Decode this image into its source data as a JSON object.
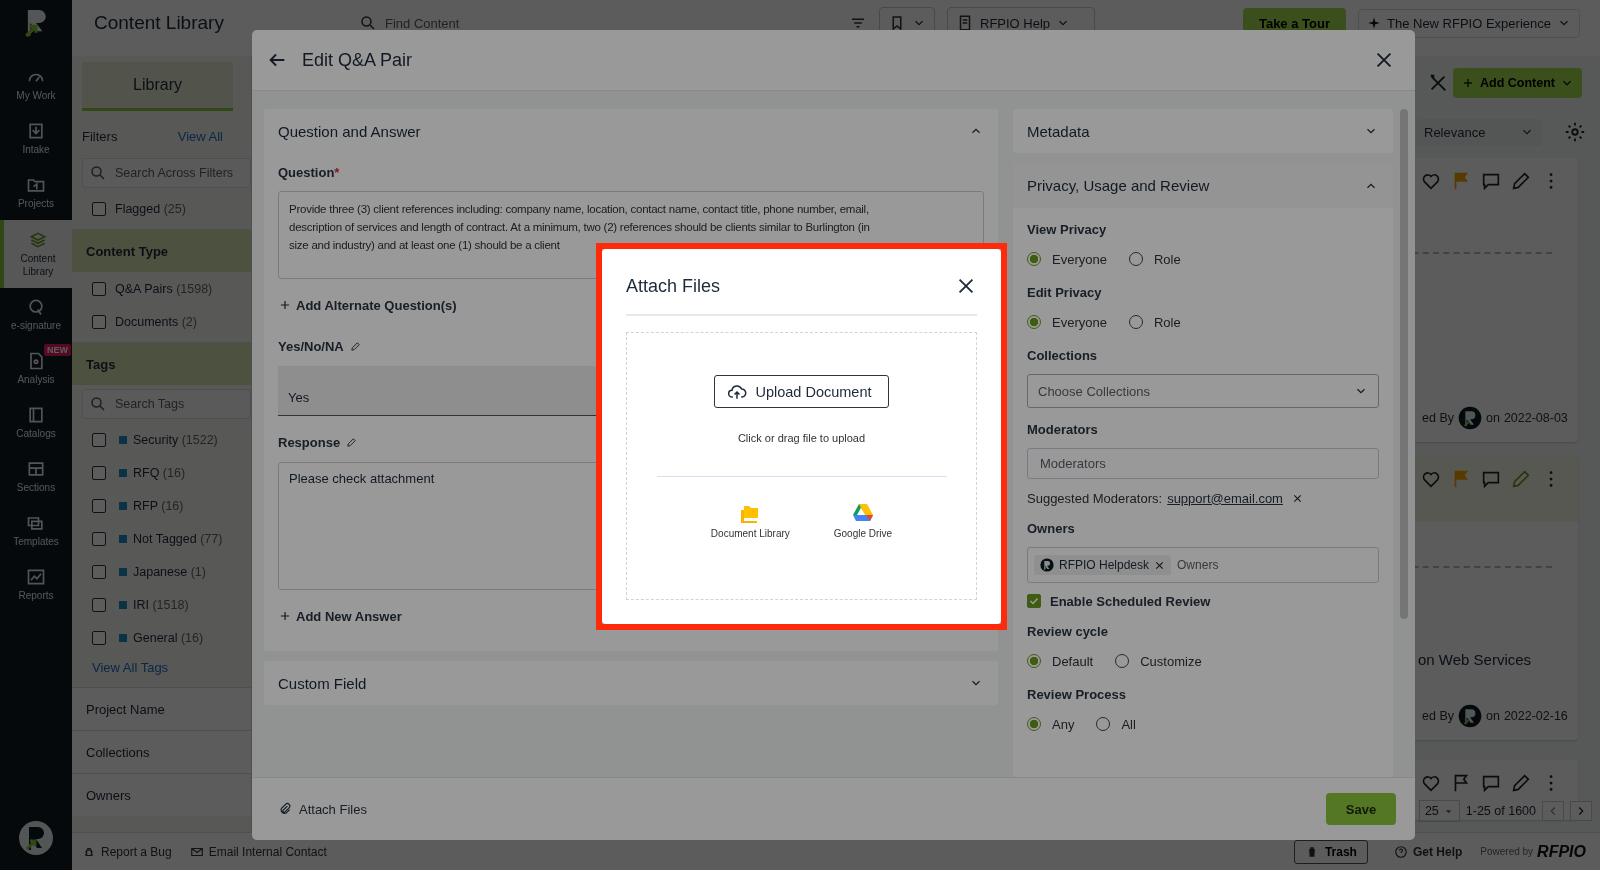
{
  "nav": {
    "items": [
      {
        "label": "My Work",
        "selected": false
      },
      {
        "label": "Intake",
        "selected": false
      },
      {
        "label": "Projects",
        "selected": false
      },
      {
        "label": "Content Library",
        "selected": true
      },
      {
        "label": "e-signature",
        "selected": false
      },
      {
        "label": "Analysis",
        "selected": false,
        "badge": "NEW"
      },
      {
        "label": "Catalogs",
        "selected": false
      },
      {
        "label": "Sections",
        "selected": false
      },
      {
        "label": "Templates",
        "selected": false
      },
      {
        "label": "Reports",
        "selected": false
      }
    ]
  },
  "header": {
    "title": "Content Library",
    "search_placeholder": "Find Content",
    "help_menu": "RFPIO Help",
    "tour_button": "Take a Tour",
    "experience_menu": "The New RFPIO Experience"
  },
  "library_tabs": [
    {
      "label": "Library",
      "selected": true
    }
  ],
  "filters": {
    "title": "Filters",
    "view_all": "View All",
    "search_placeholder": "Search Across Filters",
    "flagged": {
      "label": "Flagged",
      "count": "(25)",
      "checked": false
    },
    "sections": [
      {
        "title": "Content Type",
        "expanded": true,
        "items": [
          {
            "label": "Q&A Pairs",
            "count": "(1598)",
            "checked": false
          },
          {
            "label": "Documents",
            "count": "(2)",
            "checked": false
          }
        ]
      },
      {
        "title": "Tags",
        "expanded": true,
        "search_placeholder": "Search Tags",
        "more_link": "View All Tags",
        "items": [
          {
            "label": "Security",
            "count": "(1522)",
            "checked": false
          },
          {
            "label": "RFQ",
            "count": "(16)",
            "checked": false
          },
          {
            "label": "RFP",
            "count": "(16)",
            "checked": false
          },
          {
            "label": "Not Tagged",
            "count": "(77)",
            "checked": false
          },
          {
            "label": "Japanese",
            "count": "(1)",
            "checked": false
          },
          {
            "label": "IRI",
            "count": "(1518)",
            "checked": false
          },
          {
            "label": "General",
            "count": "(16)",
            "checked": false
          }
        ]
      },
      {
        "title": "Project Name",
        "expanded": false
      },
      {
        "title": "Collections",
        "expanded": false
      },
      {
        "title": "Owners",
        "expanded": false
      }
    ]
  },
  "results": {
    "add_button": "Add Content",
    "sort": "Relevance",
    "cards": [
      {
        "flagged": true,
        "highlighted": false,
        "author": "ed By",
        "date_prefix": "on",
        "date": "2022-08-03"
      },
      {
        "flagged": true,
        "highlighted": true,
        "excerpt": "on Web Services",
        "author": "ed By",
        "date_prefix": "on",
        "date": "2022-02-16"
      },
      {
        "flagged": false,
        "highlighted": false
      }
    ],
    "page_size": "25",
    "range": "1-25 of 1600"
  },
  "footer": {
    "links": [
      "Report a Bug",
      "Email Internal Contact"
    ],
    "trash": "Trash",
    "help": "Get Help",
    "powered_by": "Powered by",
    "brand": "RFPIO"
  },
  "edit_modal": {
    "title": "Edit Q&A Pair",
    "qa": {
      "title": "Question and Answer",
      "expanded": true,
      "question_label": "Question",
      "required_mark": "*",
      "question_lines": [
        "Provide three (3) client references including: company name, location, contact name, contact title, phone number, email,",
        "description of services and length of contract. At a minimum, two (2) references should be clients similar to Burlington (in",
        "size and industry) and at least one (1) should be a client"
      ],
      "add_alternate": "Add Alternate Question(s)",
      "yesno_label": "Yes/No/NA",
      "yesno_value": "Yes",
      "response_label": "Response",
      "response": "Please check attachment",
      "add_answer": "Add New Answer"
    },
    "custom_field": {
      "title": "Custom Field",
      "expanded": false
    },
    "metadata": {
      "title": "Metadata",
      "expanded": false
    },
    "privacy": {
      "title": "Privacy, Usage and Review",
      "expanded": true,
      "fields": [
        {
          "kind": "radio",
          "label": "View Privacy",
          "options": [
            {
              "label": "Everyone",
              "selected": true
            },
            {
              "label": "Role",
              "selected": false
            }
          ]
        },
        {
          "kind": "radio",
          "label": "Edit Privacy",
          "options": [
            {
              "label": "Everyone",
              "selected": true
            },
            {
              "label": "Role",
              "selected": false
            }
          ]
        },
        {
          "kind": "select",
          "label": "Collections",
          "placeholder": "Choose Collections"
        },
        {
          "kind": "input",
          "label": "Moderators",
          "placeholder": "Moderators"
        },
        {
          "kind": "suggestion",
          "label": "Suggested Moderators:",
          "link": "support@email.com"
        },
        {
          "kind": "owners",
          "label": "Owners",
          "chips": [
            "RFPIO Helpdesk"
          ],
          "placeholder": "Owners"
        },
        {
          "kind": "checkbox",
          "label": "Enable Scheduled Review",
          "checked": true
        },
        {
          "kind": "radio",
          "label": "Review cycle",
          "options": [
            {
              "label": "Default",
              "selected": true
            },
            {
              "label": "Customize",
              "selected": false
            }
          ]
        },
        {
          "kind": "radio",
          "label": "Review Process",
          "options": [
            {
              "label": "Any",
              "selected": true
            },
            {
              "label": "All",
              "selected": false
            }
          ]
        }
      ]
    },
    "attach_label": "Attach Files",
    "save": "Save"
  },
  "attach_dialog": {
    "title": "Attach Files",
    "highlighted": true,
    "upload_button": "Upload Document",
    "hint": "Click or drag file to upload",
    "sources": [
      {
        "label": "Document Library"
      },
      {
        "label": "Google Drive"
      }
    ]
  }
}
